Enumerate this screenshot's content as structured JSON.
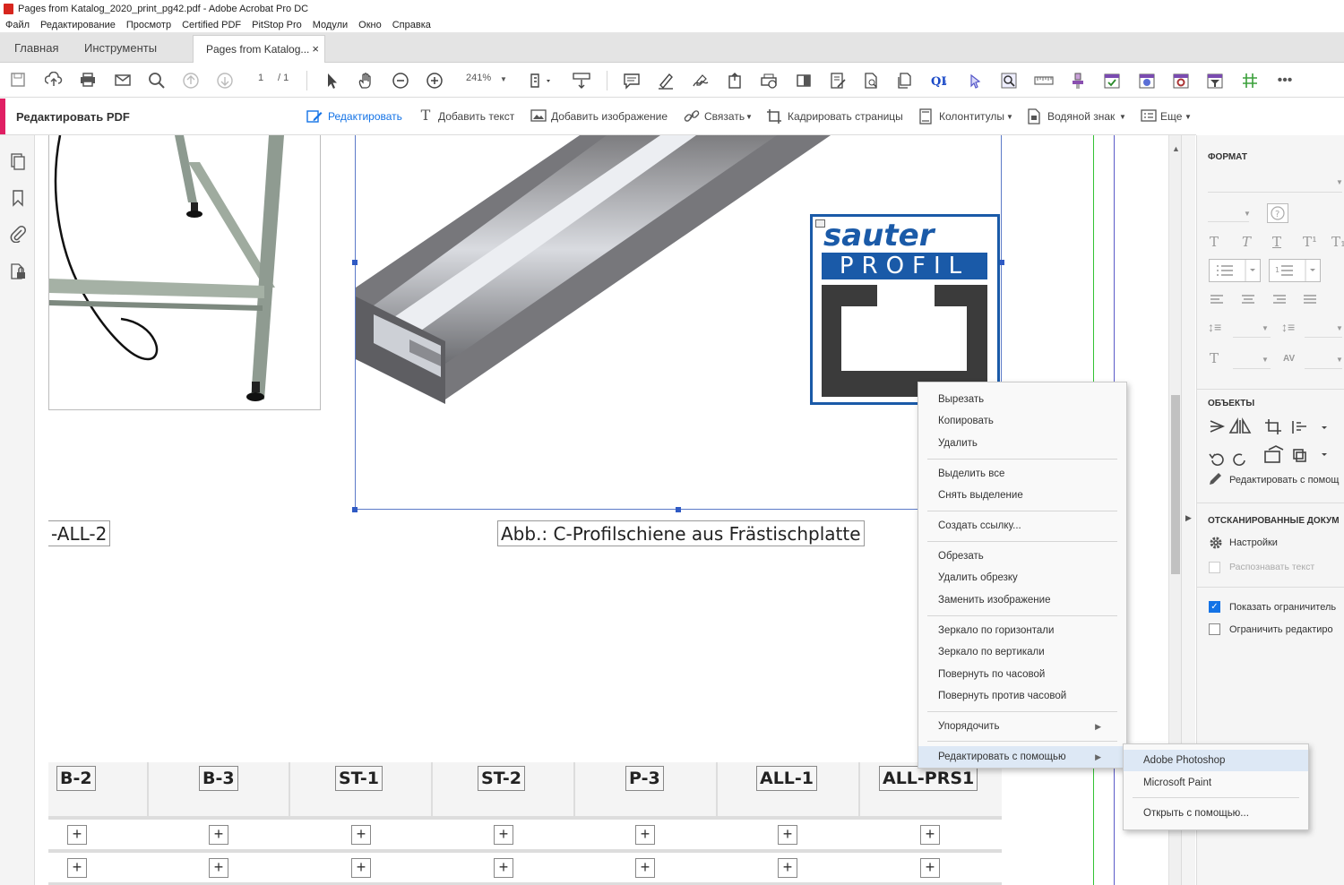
{
  "window": {
    "title": "Pages from Katalog_2020_print_pg42.pdf - Adobe Acrobat Pro DC"
  },
  "menubar": [
    "Файл",
    "Редактирование",
    "Просмотр",
    "Certified PDF",
    "PitStop Pro",
    "Модули",
    "Окно",
    "Справка"
  ],
  "tabs": {
    "home": "Главная",
    "tools": "Инструменты",
    "doc": "Pages from Katalog...",
    "close": "×"
  },
  "toolbar": {
    "page_current": "1",
    "page_total": "/ 1",
    "zoom": "241%"
  },
  "editbar": {
    "title": "Редактировать PDF",
    "edit": "Редактировать",
    "add_text": "Добавить текст",
    "add_image": "Добавить изображение",
    "link": "Связать",
    "crop": "Кадрировать страницы",
    "header_footer": "Колонтитулы",
    "watermark": "Водяной знак",
    "more": "Еще"
  },
  "document": {
    "caption": "Abb.: C-Profilschiene aus Frästischplatte",
    "left_label": "-ALL-2",
    "logo_top": "sauter",
    "logo_bottom": "PROFIL",
    "columns": [
      "B-2",
      "B-3",
      "ST-1",
      "ST-2",
      "P-3",
      "ALL-1",
      "ALL-PRS1"
    ],
    "plus": "+"
  },
  "context_menu": {
    "groups": [
      [
        "Вырезать",
        "Копировать",
        "Удалить"
      ],
      [
        "Выделить все",
        "Снять выделение"
      ],
      [
        "Создать ссылку..."
      ],
      [
        "Обрезать",
        "Удалить обрезку",
        "Заменить изображение"
      ],
      [
        "Зеркало по горизонтали",
        "Зеркало по вертикали",
        "Повернуть по часовой",
        "Повернуть против часовой"
      ],
      [
        "Упорядочить"
      ],
      [
        "Редактировать с помощью"
      ]
    ]
  },
  "submenu": {
    "items": [
      "Adobe Photoshop",
      "Microsoft Paint"
    ],
    "open_with": "Открыть с помощью..."
  },
  "right_panel": {
    "format": "ФОРМАТ",
    "objects": "ОБЪЕКТЫ",
    "edit_with": "Редактировать с помощ",
    "scanned": "ОТСКАНИРОВАННЫЕ ДОКУМ",
    "settings": "Настройки",
    "recognize": "Распознавать текст",
    "show_bounds": "Показать ограничитель",
    "restrict": "Ограничить редактиро"
  },
  "colors": {
    "accent": "#e01f63",
    "blue": "#1473e6",
    "logo_blue": "#1a5aa8"
  }
}
